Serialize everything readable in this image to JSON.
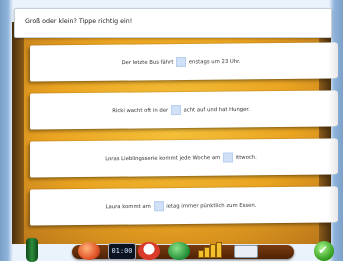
{
  "header": {
    "instruction": "Groß oder klein? Tippe richtig ein!"
  },
  "sentences": [
    {
      "before": "Der letzte Bus fährt",
      "after": "enstags um 23 Uhr."
    },
    {
      "before": "Ricki wacht oft in der",
      "after": "acht auf und hat Hunger."
    },
    {
      "before": "Loras Lieblingsserie kommt jede Woche am",
      "after": "ittwoch."
    },
    {
      "before": "Laura kommt am",
      "after": "ietag immer pünktlich zum Essen."
    }
  ],
  "toolbar": {
    "clock_display": "01:00",
    "icons": [
      "bottle-icon",
      "home-icon",
      "clock-display",
      "speedometer-icon",
      "folder-icon",
      "progress-bars-icon",
      "card-icon",
      "check-icon"
    ]
  },
  "colors": {
    "board": "#e9a321",
    "blank": "#cfe0f7",
    "toolbar": "#5a2a08"
  }
}
